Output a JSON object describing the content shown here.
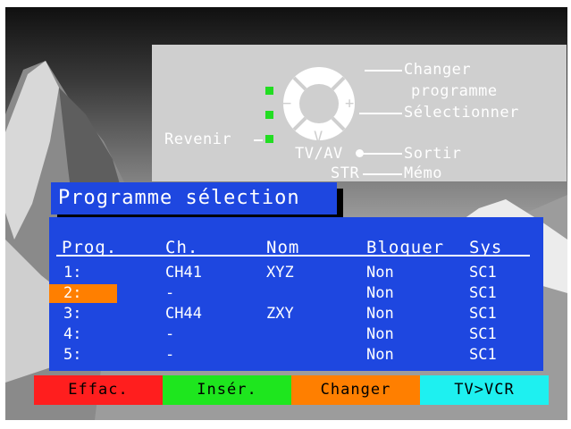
{
  "help": {
    "change_line1": "Changer",
    "change_line2": "programme",
    "select": "Sélectionner",
    "back": "Revenir",
    "tvav": "TV/AV",
    "exit": "Sortir",
    "str": "STR",
    "memo": "Mémo",
    "up_symbol": "^",
    "down_symbol": "V",
    "minus_symbol": "−",
    "plus_symbol": "+"
  },
  "title": "Programme sélection",
  "table": {
    "headers": [
      "Prog.",
      "Ch.",
      "Nom",
      "Bloquer",
      "Sys"
    ],
    "rows": [
      {
        "prog": "1:",
        "ch": "CH41",
        "nom": "XYZ",
        "bloquer": "Non",
        "sys": "SC1",
        "selected": false
      },
      {
        "prog": "2:",
        "ch": "-",
        "nom": "",
        "bloquer": "Non",
        "sys": "SC1",
        "selected": true
      },
      {
        "prog": "3:",
        "ch": "CH44",
        "nom": "ZXY",
        "bloquer": "Non",
        "sys": "SC1",
        "selected": false
      },
      {
        "prog": "4:",
        "ch": "-",
        "nom": "",
        "bloquer": "Non",
        "sys": "SC1",
        "selected": false
      },
      {
        "prog": "5:",
        "ch": "-",
        "nom": "",
        "bloquer": "Non",
        "sys": "SC1",
        "selected": false
      }
    ]
  },
  "buttons": [
    {
      "label": "Effac.",
      "color": "#ff1e1e",
      "text_color": "#000000"
    },
    {
      "label": "Insér.",
      "color": "#1ee61e",
      "text_color": "#000000"
    },
    {
      "label": "Changer",
      "color": "#ff7f00",
      "text_color": "#000000"
    },
    {
      "label": "TV>VCR",
      "color": "#1ef0f0",
      "text_color": "#000000"
    }
  ],
  "colors": {
    "panel_blue": "#1e47e0",
    "selection_orange": "#ff7f00",
    "help_panel_gray": "#cfcfcf",
    "indicator_green": "#22dd22"
  }
}
